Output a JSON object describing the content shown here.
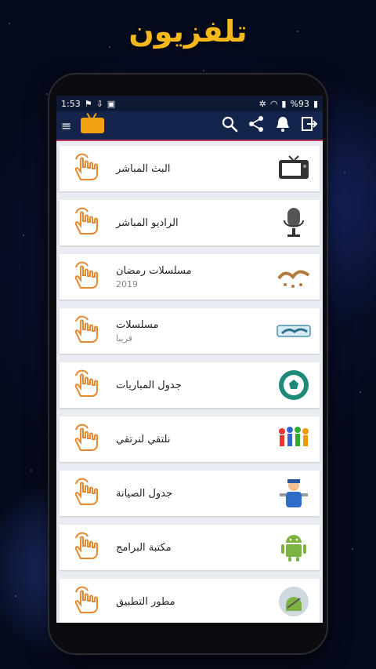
{
  "headline": "تلفزيون",
  "status": {
    "time": "1:53",
    "battery": "%93"
  },
  "app": {
    "items": [
      {
        "title": "البث المباشر",
        "subtitle": "",
        "icon": "tv-icon"
      },
      {
        "title": "الراديو المباشر",
        "subtitle": "",
        "icon": "microphone-icon"
      },
      {
        "title": "مسلسلات رمضان",
        "subtitle": "2019",
        "icon": "ramadan-icon"
      },
      {
        "title": "مسلسلات",
        "subtitle": "قريبا",
        "icon": "series-icon"
      },
      {
        "title": "جدول المباريات",
        "subtitle": "",
        "icon": "soccer-ball-icon"
      },
      {
        "title": "نلتقي لنرتقي",
        "subtitle": "",
        "icon": "people-icon"
      },
      {
        "title": "جدول الصيانة",
        "subtitle": "",
        "icon": "mechanic-icon"
      },
      {
        "title": "مكتبة البرامج",
        "subtitle": "",
        "icon": "android-icon"
      },
      {
        "title": "مطور التطبيق",
        "subtitle": "",
        "icon": "developer-icon"
      }
    ]
  },
  "colors": {
    "headline": "#f5b81c",
    "toolbar": "#14244a",
    "accent": "#c23a63",
    "hand": "#e8892e"
  }
}
